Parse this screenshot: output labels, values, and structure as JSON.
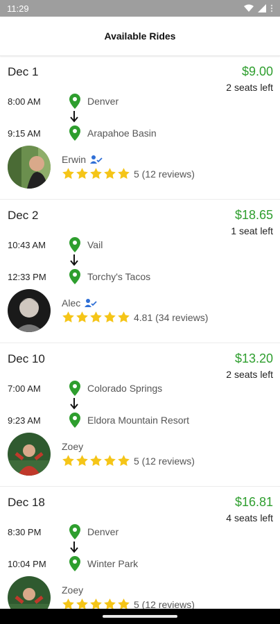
{
  "status_bar": {
    "time": "11:29"
  },
  "app_bar": {
    "title": "Available Rides"
  },
  "rides": [
    {
      "date": "Dec 1",
      "price": "$9.00",
      "seats": "2 seats left",
      "stops": [
        {
          "time": "8:00 AM",
          "place": "Denver"
        },
        {
          "time": "9:15 AM",
          "place": "Arapahoe Basin"
        }
      ],
      "driver": {
        "name": "Erwin",
        "verified": true,
        "rating_value": 5,
        "rating_text": "5 (12 reviews)"
      }
    },
    {
      "date": "Dec 2",
      "price": "$18.65",
      "seats": "1 seat left",
      "stops": [
        {
          "time": "10:43 AM",
          "place": "Vail"
        },
        {
          "time": "12:33 PM",
          "place": "Torchy's Tacos"
        }
      ],
      "driver": {
        "name": "Alec",
        "verified": true,
        "rating_value": 4.81,
        "rating_text": "4.81 (34 reviews)"
      }
    },
    {
      "date": "Dec 10",
      "price": "$13.20",
      "seats": "2 seats left",
      "stops": [
        {
          "time": "7:00 AM",
          "place": "Colorado Springs"
        },
        {
          "time": "9:23 AM",
          "place": "Eldora Mountain Resort"
        }
      ],
      "driver": {
        "name": "Zoey",
        "verified": false,
        "rating_value": 5,
        "rating_text": "5 (12 reviews)"
      }
    },
    {
      "date": "Dec 18",
      "price": "$16.81",
      "seats": "4 seats left",
      "stops": [
        {
          "time": "8:30 PM",
          "place": "Denver"
        },
        {
          "time": "10:04 PM",
          "place": "Winter Park"
        }
      ],
      "driver": {
        "name": "Zoey",
        "verified": false,
        "rating_value": 5,
        "rating_text": "5 (12 reviews)"
      }
    }
  ],
  "colors": {
    "price": "#2e9e2e",
    "pin": "#2e9e2e",
    "star": "#f5c518",
    "verified": "#2f6fd6",
    "status_bar": "#9e9e9e"
  },
  "icons": {
    "pin": "location-pin-icon",
    "arrow": "arrow-down-icon",
    "verified": "verified-user-icon",
    "star": "star-icon"
  }
}
